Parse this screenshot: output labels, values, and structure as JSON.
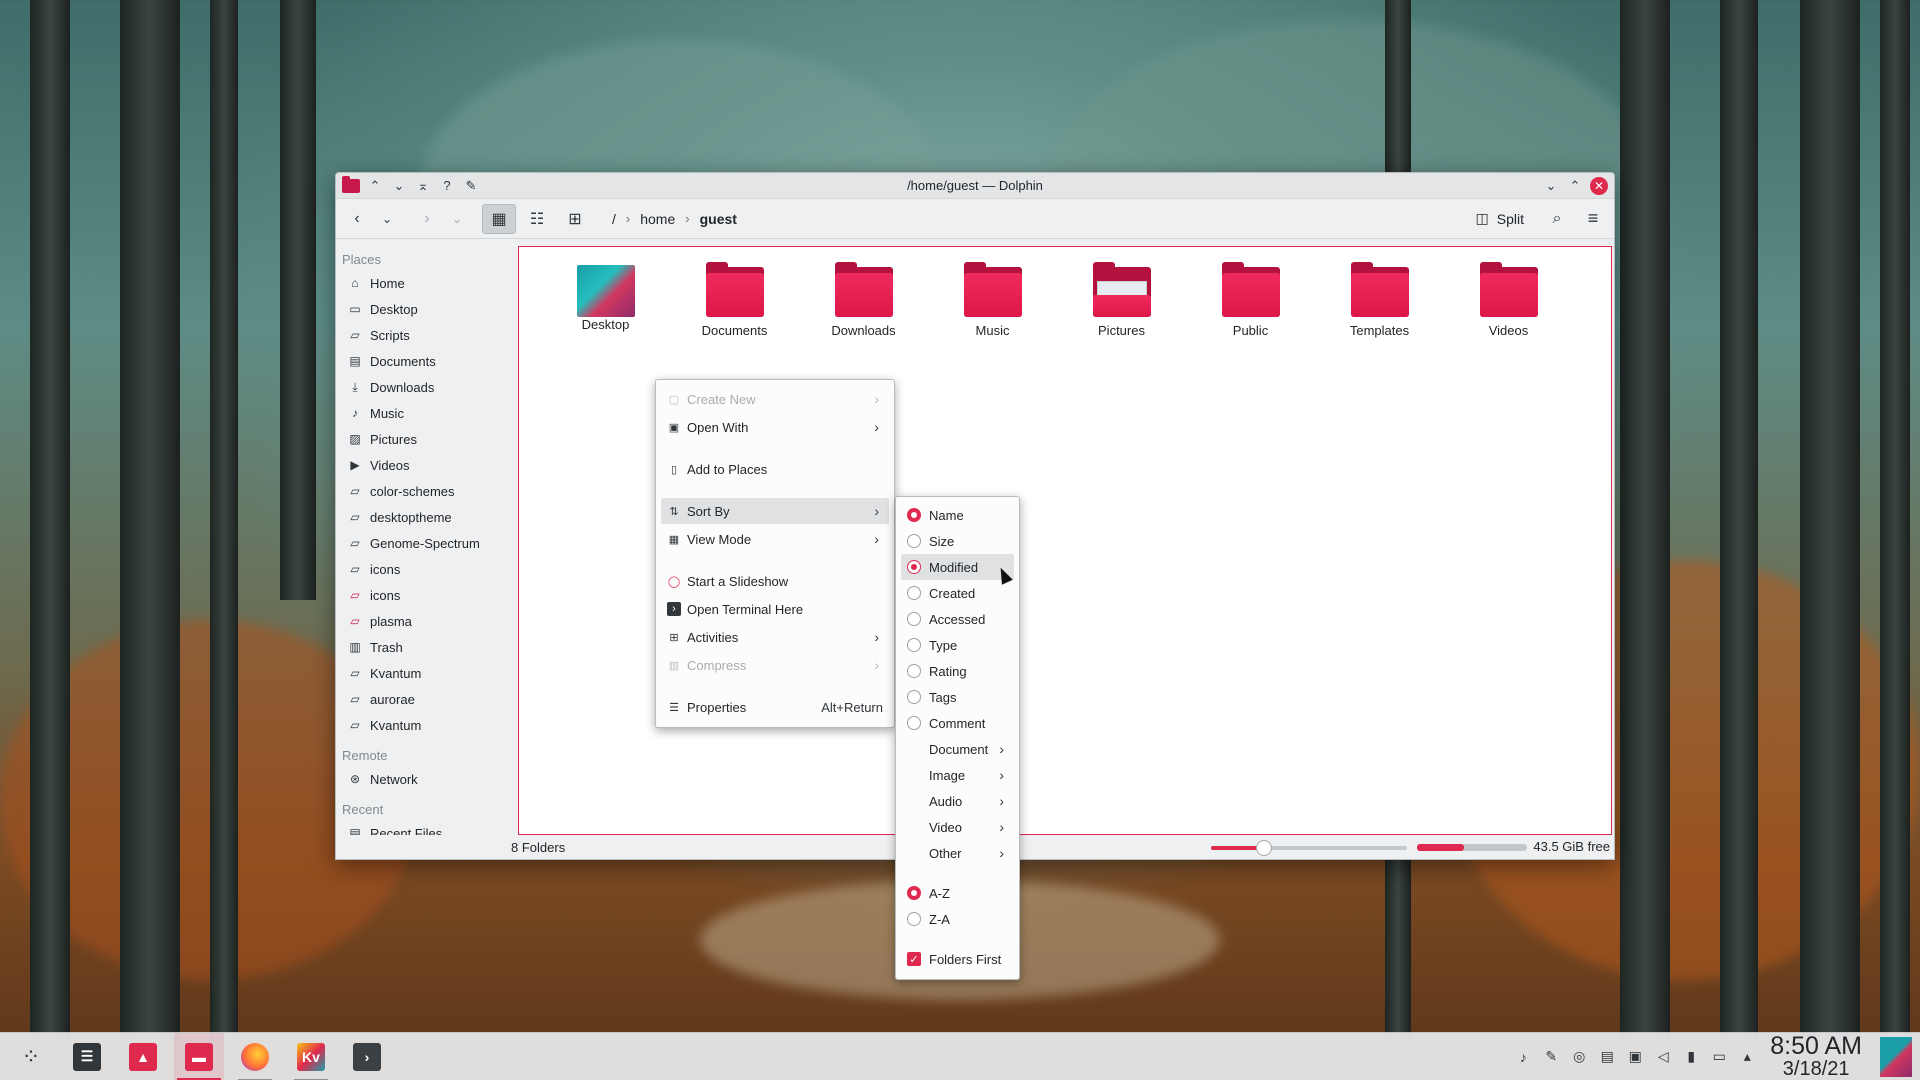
{
  "window": {
    "title": "/home/guest — Dolphin"
  },
  "toolbar": {
    "breadcrumb": [
      "/",
      "home",
      "guest"
    ],
    "split_label": "Split"
  },
  "places": {
    "section_places": "Places",
    "items": [
      {
        "label": "Home",
        "icon": "home-icon"
      },
      {
        "label": "Desktop",
        "icon": "desktop-icon"
      },
      {
        "label": "Scripts",
        "icon": "folder-icon"
      },
      {
        "label": "Documents",
        "icon": "documents-icon"
      },
      {
        "label": "Downloads",
        "icon": "download-icon"
      },
      {
        "label": "Music",
        "icon": "music-icon"
      },
      {
        "label": "Pictures",
        "icon": "pictures-icon"
      },
      {
        "label": "Videos",
        "icon": "videos-icon"
      },
      {
        "label": "color-schemes",
        "icon": "folder-icon"
      },
      {
        "label": "desktoptheme",
        "icon": "folder-icon"
      },
      {
        "label": "Genome-Spectrum",
        "icon": "folder-icon"
      },
      {
        "label": "icons",
        "icon": "folder-icon"
      },
      {
        "label": "icons",
        "icon": "folder-red-icon"
      },
      {
        "label": "plasma",
        "icon": "folder-red-icon"
      },
      {
        "label": "Trash",
        "icon": "trash-icon"
      },
      {
        "label": "Kvantum",
        "icon": "folder-icon"
      },
      {
        "label": "aurorae",
        "icon": "folder-icon"
      },
      {
        "label": "Kvantum",
        "icon": "folder-icon"
      }
    ],
    "section_remote": "Remote",
    "network": "Network",
    "section_recent": "Recent",
    "recent_files": "Recent Files"
  },
  "folders": [
    "Desktop",
    "Documents",
    "Downloads",
    "Music",
    "Pictures",
    "Public",
    "Templates",
    "Videos"
  ],
  "status": {
    "count": "8 Folders",
    "free": "43.5 GiB free",
    "zoom_fraction": 0.27,
    "space_used_fraction": 0.43
  },
  "context_menu": {
    "create_new": "Create New",
    "open_with": "Open With",
    "add_to_places": "Add to Places",
    "sort_by": "Sort By",
    "view_mode": "View Mode",
    "start_slideshow": "Start a Slideshow",
    "open_terminal": "Open Terminal Here",
    "activities": "Activities",
    "compress": "Compress",
    "properties": "Properties",
    "properties_shortcut": "Alt+Return"
  },
  "sort_menu": {
    "name": "Name",
    "size": "Size",
    "modified": "Modified",
    "created": "Created",
    "accessed": "Accessed",
    "type": "Type",
    "rating": "Rating",
    "tags": "Tags",
    "comment": "Comment",
    "document": "Document",
    "image": "Image",
    "audio": "Audio",
    "video": "Video",
    "other": "Other",
    "az": "A-Z",
    "za": "Z-A",
    "folders_first": "Folders First"
  },
  "clock": {
    "time": "8:50 AM",
    "date": "3/18/21"
  },
  "colors": {
    "accent": "#e0294e",
    "folder": "#dd1849"
  }
}
